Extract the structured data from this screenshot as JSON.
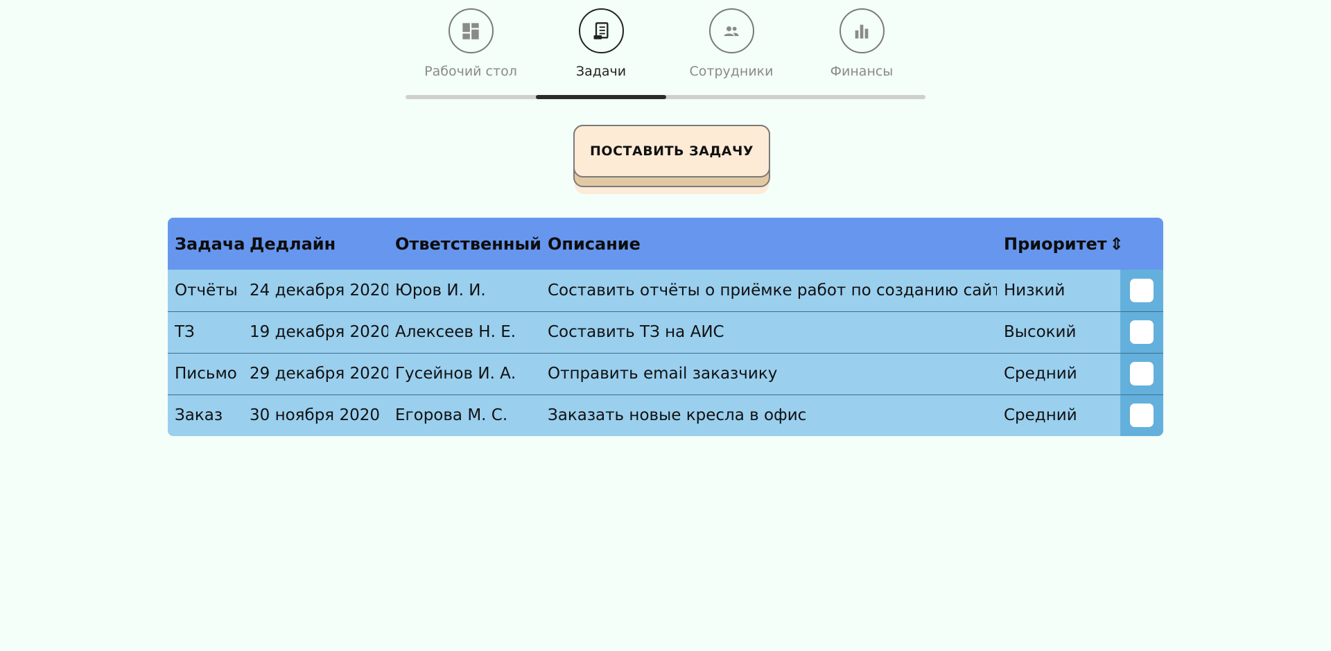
{
  "nav": {
    "items": [
      {
        "label": "Рабочий стол",
        "icon": "dashboard-icon"
      },
      {
        "label": "Задачи",
        "icon": "task-document-icon"
      },
      {
        "label": "Сотрудники",
        "icon": "people-icon"
      },
      {
        "label": "Финансы",
        "icon": "bar-chart-icon"
      }
    ],
    "active_index": 1
  },
  "action_button": {
    "label": "ПОСТАВИТЬ ЗАДАЧУ"
  },
  "table": {
    "columns": [
      "Задача",
      "Дедлайн",
      "Ответственный",
      "Описание",
      "Приоритет"
    ],
    "sort_icon": "⇕",
    "rows": [
      {
        "task": "Отчёты",
        "deadline": "24 декабря 2020",
        "assignee": "Юров И. И.",
        "description": "Составить отчёты о приёмке работ по созданию сайта",
        "priority": "Низкий",
        "done": false
      },
      {
        "task": "ТЗ",
        "deadline": "19 декабря 2020",
        "assignee": "Алексеев Н. Е.",
        "description": "Составить ТЗ на АИС",
        "priority": "Высокий",
        "done": false
      },
      {
        "task": "Письмо",
        "deadline": "29 декабря 2020",
        "assignee": "Гусейнов И. А.",
        "description": "Отправить email заказчику",
        "priority": "Средний",
        "done": false
      },
      {
        "task": "Заказ",
        "deadline": "30 ноября 2020",
        "assignee": "Егорова М. С.",
        "description": "Заказать новые кресла в офис",
        "priority": "Средний",
        "done": false
      }
    ]
  },
  "colors": {
    "background": "#f3fff8",
    "table_header": "#6696ee",
    "table_row": "#9acfee",
    "checkbox_column": "#64b0dc",
    "button_face": "#fdebd6",
    "button_base": "#e3c9a3"
  }
}
